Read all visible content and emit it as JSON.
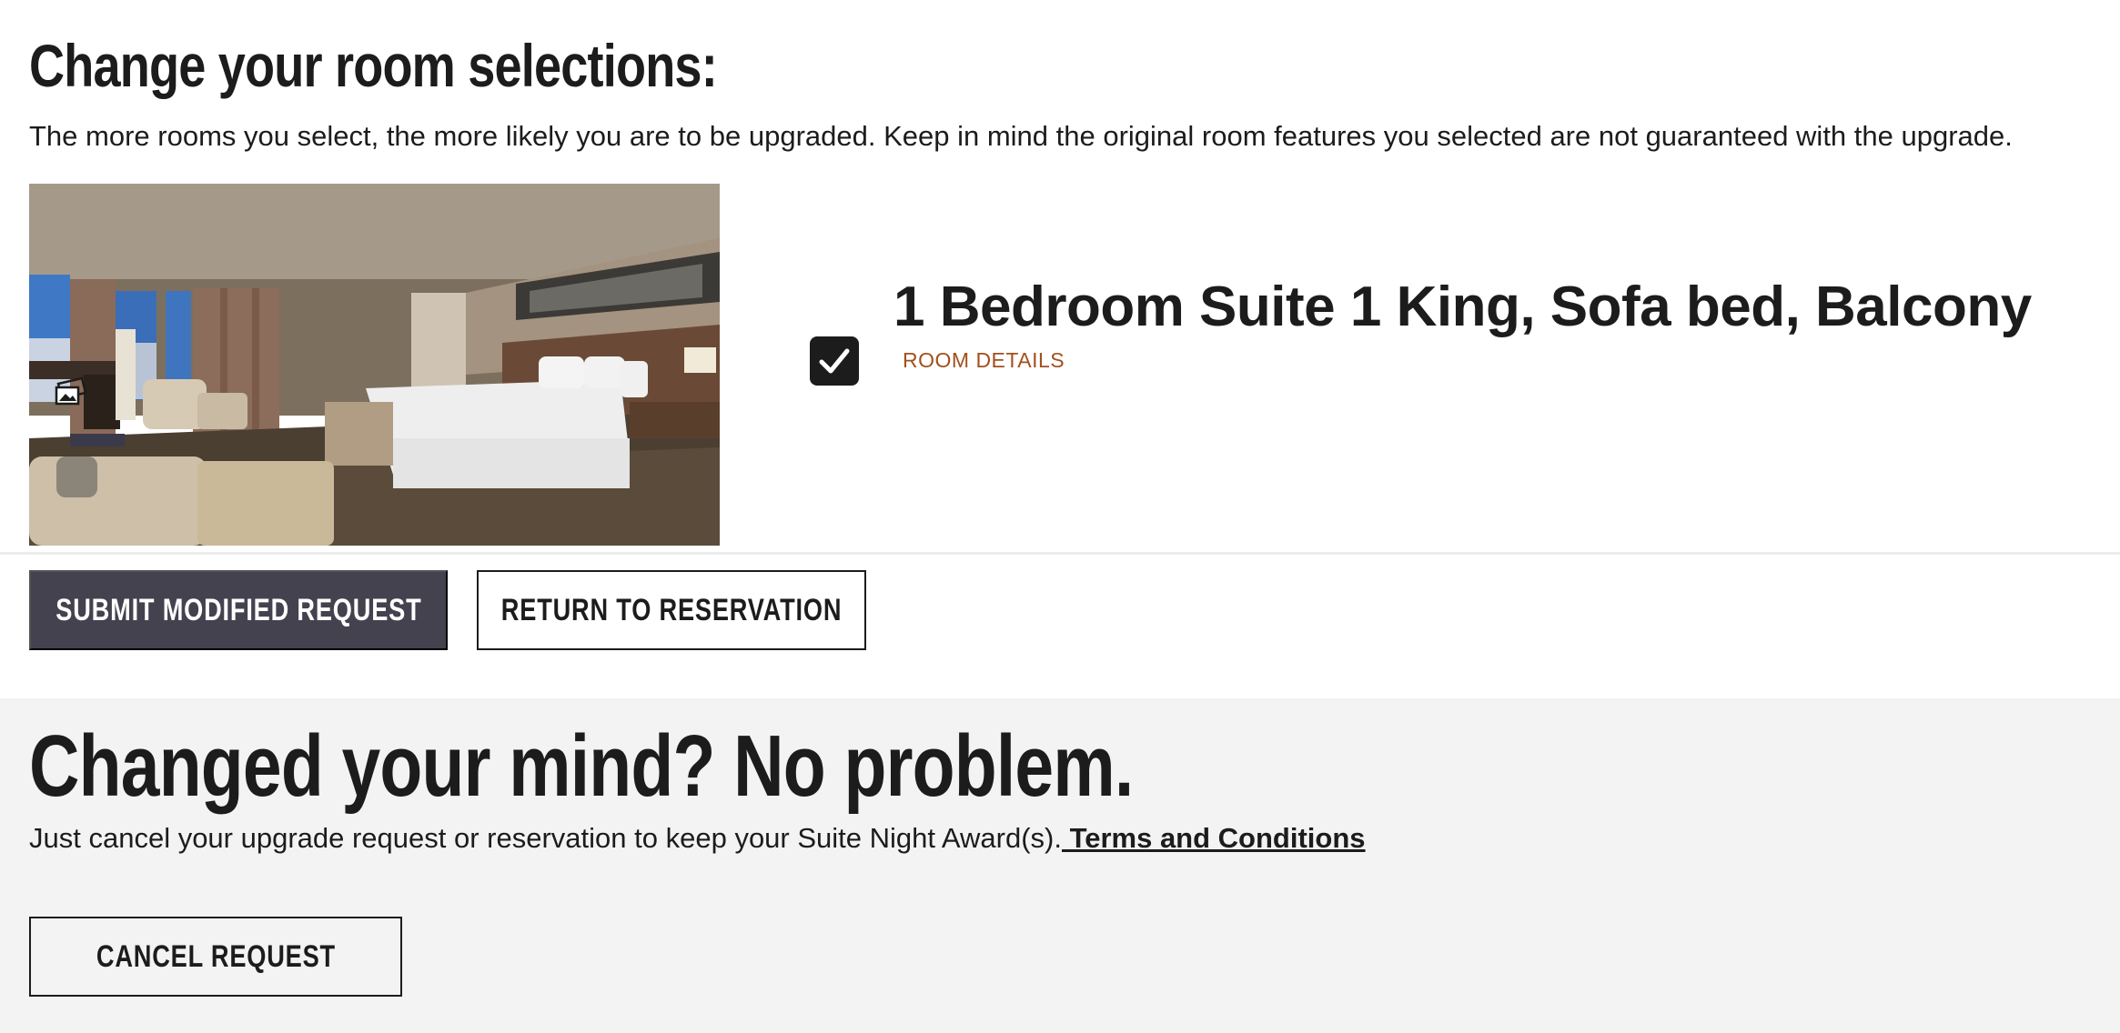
{
  "selection": {
    "heading": "Change your room selections:",
    "description": "The more rooms you select, the more likely you are to be upgraded. Keep in mind the original room features you selected are not guaranteed with the upgrade."
  },
  "room": {
    "title": "1 Bedroom Suite 1 King, Sofa bed, Balcony",
    "details_link": "ROOM DETAILS",
    "selected": true,
    "gallery_icon": "gallery-icon"
  },
  "actions": {
    "submit_label": "SUBMIT MODIFIED REQUEST",
    "return_label": "RETURN TO RESERVATION"
  },
  "cancel_section": {
    "heading": "Changed your mind? No problem.",
    "text": "Just cancel your upgrade request or reservation to keep your Suite Night Award(s).",
    "terms_link": " Terms and Conditions",
    "cancel_label": "CANCEL REQUEST"
  },
  "colors": {
    "primary_button": "#44424f",
    "link_accent": "#a2501e",
    "text": "#1c1c1c",
    "section_background": "#f3f3f3"
  }
}
